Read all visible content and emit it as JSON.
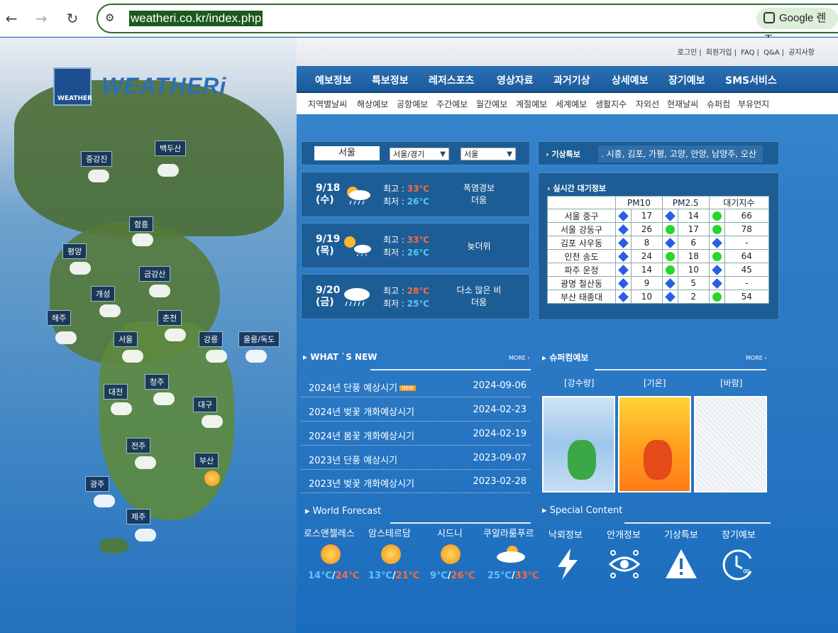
{
  "browser": {
    "url": "weatheri.co.kr/index.php",
    "lens_label": "Google 렌즈"
  },
  "site": {
    "logo_small": "WEATHER",
    "logo_text": "WEATHERi",
    "top_links": [
      "로그인",
      "회원가입",
      "FAQ",
      "Q&A",
      "공지사항"
    ],
    "main_nav": [
      "예보정보",
      "특보정보",
      "레저스포츠",
      "영상자료",
      "과거기상",
      "상세예보",
      "장기예보",
      "SMS서비스"
    ],
    "sub_nav": [
      "지역별날씨",
      "해상예보",
      "공항예보",
      "주간예보",
      "월간예보",
      "계절예보",
      "세계예보",
      "생활지수",
      "자외선",
      "현재날씨",
      "슈퍼컴",
      "부유먼지"
    ]
  },
  "map": {
    "cities": [
      "중강진",
      "백두산",
      "함흥",
      "평양",
      "금강산",
      "개성",
      "해주",
      "춘천",
      "서울",
      "강릉",
      "울릉/독도",
      "청주",
      "대전",
      "대구",
      "전주",
      "부산",
      "광주",
      "제주"
    ]
  },
  "city_select": {
    "current": "서울",
    "region": "서울/경기",
    "city": "서울"
  },
  "forecast": [
    {
      "date": "9/18",
      "dow": "(수)",
      "hi_label": "최고 :",
      "hi": "33℃",
      "lo_label": "최저 :",
      "lo": "26℃",
      "desc1": "폭염경보",
      "desc2": "더움"
    },
    {
      "date": "9/19",
      "dow": "(목)",
      "hi_label": "최고 :",
      "hi": "33℃",
      "lo_label": "최저 :",
      "lo": "26℃",
      "desc1": "늦더위",
      "desc2": ""
    },
    {
      "date": "9/20",
      "dow": "(금)",
      "hi_label": "최고 :",
      "hi": "28℃",
      "lo_label": "최저 :",
      "lo": "25℃",
      "desc1": "다소 많은 비",
      "desc2": "더움"
    }
  ],
  "alert": {
    "label": "기상특보",
    "text": ". 시흥, 김포, 가평, 고양, 안양, 남양주, 오산"
  },
  "air": {
    "title": "실시간 대기정보",
    "headers": [
      "PM10",
      "PM2.5",
      "대기지수"
    ],
    "rows": [
      {
        "name": "서울 중구",
        "pm10": "17",
        "pm10c": "blue",
        "pm25": "14",
        "pm25c": "blue",
        "aqi": "66",
        "aqic": "green"
      },
      {
        "name": "서울 강동구",
        "pm10": "26",
        "pm10c": "blue",
        "pm25": "17",
        "pm25c": "green",
        "aqi": "78",
        "aqic": "green"
      },
      {
        "name": "김포 사우동",
        "pm10": "8",
        "pm10c": "blue",
        "pm25": "6",
        "pm25c": "blue",
        "aqi": "-",
        "aqic": "blue"
      },
      {
        "name": "인천 송도",
        "pm10": "24",
        "pm10c": "blue",
        "pm25": "18",
        "pm25c": "green",
        "aqi": "64",
        "aqic": "green"
      },
      {
        "name": "파주 운정",
        "pm10": "14",
        "pm10c": "blue",
        "pm25": "10",
        "pm25c": "green",
        "aqi": "45",
        "aqic": "blue"
      },
      {
        "name": "광명 철산동",
        "pm10": "9",
        "pm10c": "blue",
        "pm25": "5",
        "pm25c": "blue",
        "aqi": "-",
        "aqic": "blue"
      },
      {
        "name": "부산 태종대",
        "pm10": "10",
        "pm10c": "blue",
        "pm25": "2",
        "pm25c": "blue",
        "aqi": "54",
        "aqic": "green"
      }
    ]
  },
  "whats_new": {
    "title": "WHAT `S NEW",
    "more": "MORE",
    "new_badge": "NEW",
    "items": [
      {
        "title": "2024년 단풍 예상시기",
        "date": "2024-09-06"
      },
      {
        "title": "2024년 벚꽃 개화예상시기",
        "date": "2024-02-23"
      },
      {
        "title": "2024년 봄꽃 개화예상시기",
        "date": "2024-02-19"
      },
      {
        "title": "2023년 단풍 예상시기",
        "date": "2023-09-07"
      },
      {
        "title": "2023년 벚꽃 개화예상시기",
        "date": "2023-02-28"
      }
    ]
  },
  "supercom": {
    "title": "슈퍼컴예보",
    "more": "MORE",
    "labels": [
      "[강수량]",
      "[기온]",
      "[바람]"
    ]
  },
  "world": {
    "title": "World Forecast",
    "cities": [
      {
        "name": "로스앤젤레스",
        "lo": "14℃",
        "hi": "24℃",
        "icon": "sun"
      },
      {
        "name": "암스테르담",
        "lo": "13℃",
        "hi": "21℃",
        "icon": "sun"
      },
      {
        "name": "시드니",
        "lo": "9℃",
        "hi": "26℃",
        "icon": "sun"
      },
      {
        "name": "쿠알라룸푸르",
        "lo": "25℃",
        "hi": "33℃",
        "icon": "cloud-sun"
      }
    ]
  },
  "special": {
    "title": "Special Content",
    "items": [
      "낙뢰정보",
      "안개정보",
      "기상특보",
      "장기예보"
    ]
  },
  "colors": {
    "page_bg": "#2a77c3",
    "hi_temp": "#ff6a3d",
    "lo_temp": "#5cc5ff",
    "aq_good": "#26d62a",
    "aq_very_good": "#2b5de0"
  }
}
